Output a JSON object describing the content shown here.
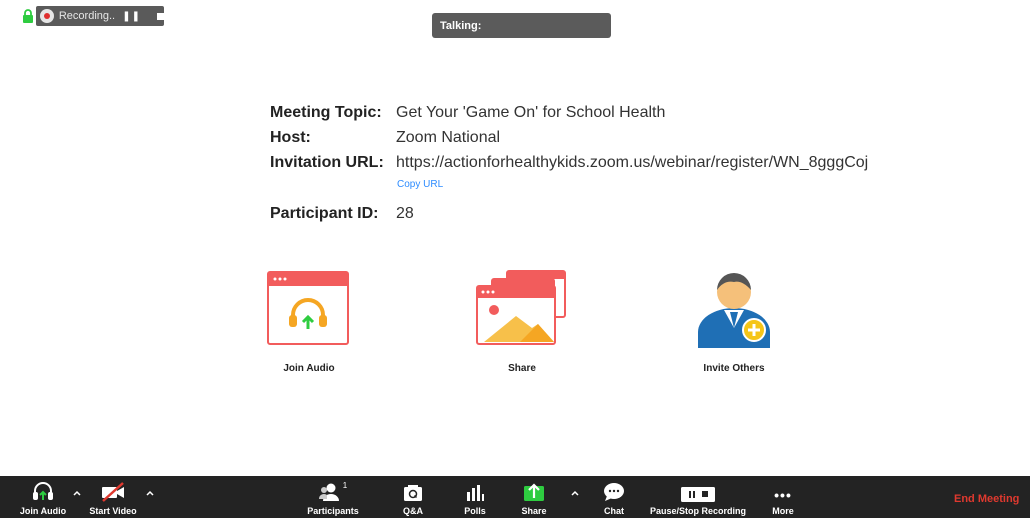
{
  "recording": {
    "status_label": "Recording...",
    "pause_glyph": "❚❚"
  },
  "talking": {
    "label": "Talking:"
  },
  "meeting_info": {
    "topic_label": "Meeting Topic:",
    "topic_value": "Get Your 'Game On' for School Health",
    "host_label": "Host:",
    "host_value": "Zoom National",
    "url_label": "Invitation URL:",
    "url_value": "https://actionforhealthykids.zoom.us/webinar/register/WN_8gggCoj",
    "copy_url_label": "Copy URL",
    "participant_id_label": "Participant ID:",
    "participant_id_value": "28"
  },
  "actions": {
    "join_audio_label": "Join Audio",
    "share_label": "Share",
    "invite_label": "Invite Others"
  },
  "toolbar": {
    "join_audio_label": "Join Audio",
    "start_video_label": "Start Video",
    "participants_label": "Participants",
    "participants_count": "1",
    "qa_label": "Q&A",
    "polls_label": "Polls",
    "share_label": "Share",
    "chat_label": "Chat",
    "recording_label": "Pause/Stop Recording",
    "more_label": "More",
    "more_glyph": "•••",
    "end_meeting_label": "End Meeting"
  },
  "colors": {
    "accent_green": "#2ecc40",
    "end_meeting_red": "#e0392f",
    "link_blue": "#2d8cff",
    "icon_red": "#f25c5c",
    "toolbar_bg": "#232323"
  }
}
